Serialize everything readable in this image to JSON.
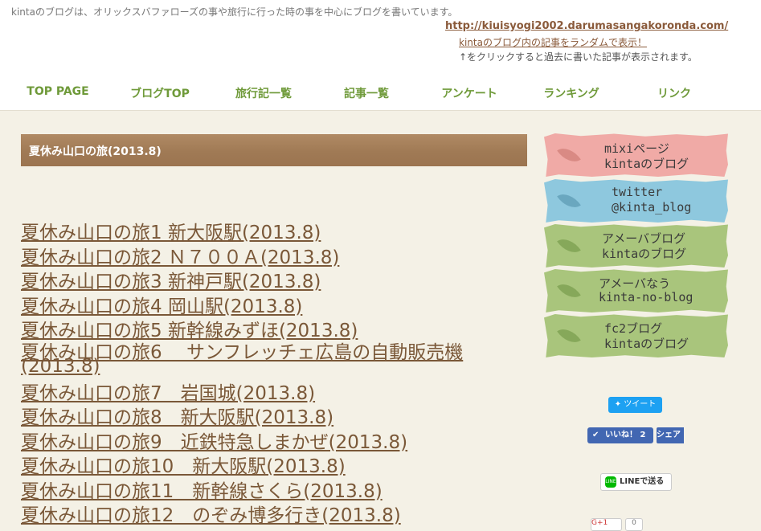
{
  "header": {
    "tagline": "kintaのブログは、オリックスバファローズの事や旅行に行った時の事を中心にブログを書いています。",
    "site_url": "http://kiuisyogi2002.darumasangakoronda.com/",
    "random_link": "kintaのブログ内の記事をランダムで表示！",
    "random_note": "↑をクリックすると過去に書いた記事が表示されます。"
  },
  "nav": {
    "items": [
      {
        "label": "TOP PAGE"
      },
      {
        "label": "ブログTOP"
      },
      {
        "label": "旅行記一覧"
      },
      {
        "label": "記事一覧"
      },
      {
        "label": "アンケート"
      },
      {
        "label": "ランキング"
      },
      {
        "label": "リンク"
      }
    ]
  },
  "main": {
    "title": "夏休み山口の旅(2013.8)",
    "articles": [
      "夏休み山口の旅1 新大阪駅(2013.8)",
      "夏休み山口の旅2 Ｎ７００Ａ(2013.8)",
      "夏休み山口の旅3 新神戸駅(2013.8)",
      "夏休み山口の旅4 岡山駅(2013.8)",
      "夏休み山口の旅5 新幹線みずほ(2013.8)",
      "夏休み山口の旅6　 サンフレッチェ広島の自動販売機(2013.8)",
      "夏休み山口の旅7　岩国城(2013.8)",
      "夏休み山口の旅8　新大阪駅(2013.8)",
      "夏休み山口の旅9　近鉄特急しまかぜ(2013.8)",
      "夏休み山口の旅10　新大阪駅(2013.8)",
      "夏休み山口の旅11　新幹線さくら(2013.8)",
      "夏休み山口の旅12　のぞみ博多行き(2013.8)"
    ]
  },
  "sidebar": {
    "banners": [
      {
        "line1": "mixiページ",
        "line2": "kintaのブログ",
        "color": "#f0aaa6",
        "leaf": "#d98a84"
      },
      {
        "line1": "twitter",
        "line2": "@kinta_blog",
        "color": "#8ec8de",
        "leaf": "#6aa7bf"
      },
      {
        "line1": "アメーバブログ",
        "line2": "kintaのブログ",
        "color": "#a9c57c",
        "leaf": "#86a85a"
      },
      {
        "line1": "アメーバなう",
        "line2": "kinta-no-blog",
        "color": "#a9c57c",
        "leaf": "#86a85a"
      },
      {
        "line1": "fc2ブログ",
        "line2": "kintaのブログ",
        "color": "#a9c57c",
        "leaf": "#86a85a"
      }
    ]
  },
  "social": {
    "tweet": "ツイート",
    "like": "いいね！ 2",
    "share": "シェア",
    "line": "LINEで送る",
    "gplus": "G+1",
    "gplus_count": "0"
  },
  "colors": {
    "nav_text": "#6f9a3a",
    "title_bar": "#a07a55",
    "link": "#7a5838",
    "background": "#f4f1e6"
  }
}
